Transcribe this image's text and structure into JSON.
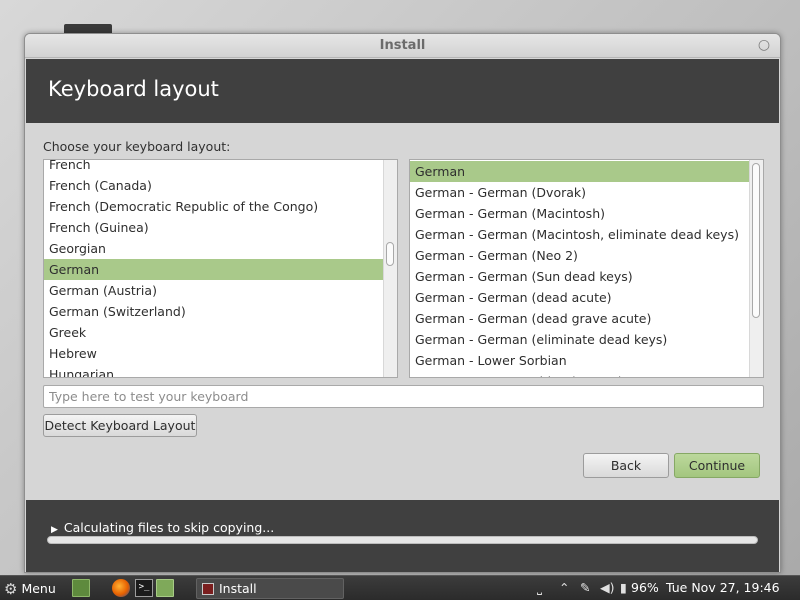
{
  "window": {
    "title": "Install",
    "close_glyph": "○"
  },
  "header": {
    "heading": "Keyboard layout"
  },
  "main": {
    "prompt": "Choose your keyboard layout:",
    "layouts": [
      {
        "label": "French",
        "selected": false
      },
      {
        "label": "French (Canada)",
        "selected": false
      },
      {
        "label": "French (Democratic Republic of the Congo)",
        "selected": false
      },
      {
        "label": "French (Guinea)",
        "selected": false
      },
      {
        "label": "Georgian",
        "selected": false
      },
      {
        "label": "German",
        "selected": true
      },
      {
        "label": "German (Austria)",
        "selected": false
      },
      {
        "label": "German (Switzerland)",
        "selected": false
      },
      {
        "label": "Greek",
        "selected": false
      },
      {
        "label": "Hebrew",
        "selected": false
      },
      {
        "label": "Hungarian",
        "selected": false
      }
    ],
    "variants": [
      {
        "label": "German",
        "selected": true
      },
      {
        "label": "German - German (Dvorak)",
        "selected": false
      },
      {
        "label": "German - German (Macintosh)",
        "selected": false
      },
      {
        "label": "German - German (Macintosh, eliminate dead keys)",
        "selected": false
      },
      {
        "label": "German - German (Neo 2)",
        "selected": false
      },
      {
        "label": "German - German (Sun dead keys)",
        "selected": false
      },
      {
        "label": "German - German (dead acute)",
        "selected": false
      },
      {
        "label": "German - German (dead grave acute)",
        "selected": false
      },
      {
        "label": "German - German (eliminate dead keys)",
        "selected": false
      },
      {
        "label": "German - Lower Sorbian",
        "selected": false
      },
      {
        "label": "German - Lower Sorbian (qwertz)",
        "selected": false
      }
    ],
    "test_input": {
      "value": "",
      "placeholder": "Type here to test your keyboard"
    },
    "detect_label": "Detect Keyboard Layout",
    "back_label": "Back",
    "continue_label": "Continue"
  },
  "footer": {
    "progress_text": "Calculating files to skip copying...",
    "progress_fraction": 0
  },
  "taskbar": {
    "menu_label": "Menu",
    "task_label": "Install",
    "terminal_glyph": ">_",
    "battery": "96%",
    "clock": "Tue Nov 27, 19:46"
  },
  "colors": {
    "header_bg": "#404040",
    "selection": "#a9c98a",
    "continue_button": "#a3c67f"
  }
}
